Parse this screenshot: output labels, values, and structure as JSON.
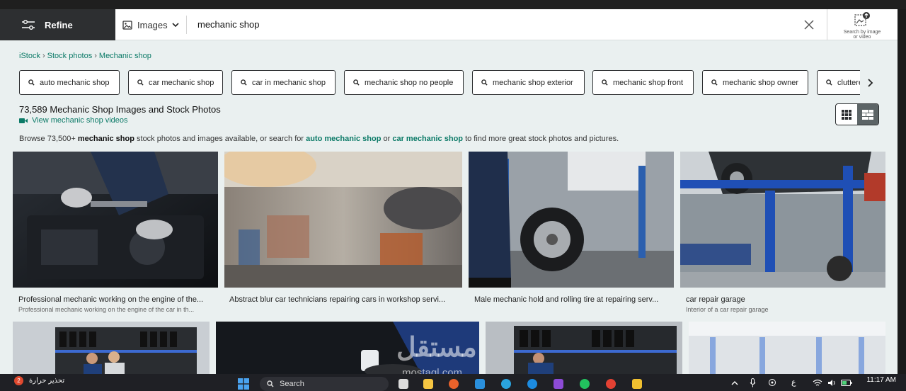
{
  "header": {
    "refine_label": "Refine",
    "media_type": "Images",
    "query": "mechanic shop",
    "search_by_image_line1": "Search by image",
    "search_by_image_line2": "or video"
  },
  "breadcrumb": [
    "iStock",
    "Stock photos",
    "Mechanic shop"
  ],
  "chips": [
    "auto mechanic shop",
    "car mechanic shop",
    "car in mechanic shop",
    "mechanic shop no people",
    "mechanic shop exterior",
    "mechanic shop front",
    "mechanic shop owner",
    "cluttered"
  ],
  "results": {
    "count_title": "73,589 Mechanic Shop Images and Stock Photos",
    "video_link": "View mechanic shop videos",
    "browse_pre": "Browse 73,500+ ",
    "browse_term": "mechanic shop",
    "browse_mid": " stock photos and images available, or search for ",
    "browse_link1": "auto mechanic shop",
    "browse_or": " or ",
    "browse_link2": "car mechanic shop",
    "browse_post": " to find more great stock photos and pictures."
  },
  "images": [
    {
      "title": "Professional mechanic working on the engine of the...",
      "subtitle": "Professional mechanic working on the engine of the car in th..."
    },
    {
      "title": "Abstract blur car technicians repairing cars in workshop servi...",
      "subtitle": ""
    },
    {
      "title": "Male mechanic hold and rolling tire at repairing serv...",
      "subtitle": ""
    },
    {
      "title": "car repair garage",
      "subtitle": "Interior of a car repair garage"
    }
  ],
  "watermark": {
    "arabic": "مستقل",
    "latin": "mostaql.com"
  },
  "taskbar": {
    "notification_count": "2",
    "weather_text": "تحذير حرارة",
    "search_label": "Search",
    "lang": "ع",
    "time": "11:17 AM"
  },
  "colors": {
    "accent": "#0b7a67",
    "refine_bg": "#2d2f31",
    "page_bg": "#eaf0f0"
  }
}
